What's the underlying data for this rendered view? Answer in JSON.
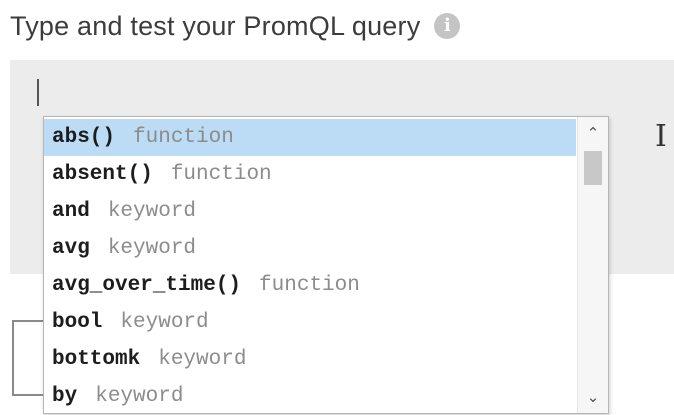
{
  "header": {
    "title": "Type and test your PromQL query",
    "info_icon": "info-icon",
    "info_glyph": "i"
  },
  "editor": {
    "value": "",
    "mouse_cursor": "text-cursor-icon",
    "mouse_glyph": "I"
  },
  "autocomplete": {
    "selected_index": 0,
    "items": [
      {
        "name": "abs()",
        "type": "function"
      },
      {
        "name": "absent()",
        "type": "function"
      },
      {
        "name": "and",
        "type": "keyword"
      },
      {
        "name": "avg",
        "type": "keyword"
      },
      {
        "name": "avg_over_time()",
        "type": "function"
      },
      {
        "name": "bool",
        "type": "keyword"
      },
      {
        "name": "bottomk",
        "type": "keyword"
      },
      {
        "name": "by",
        "type": "keyword"
      }
    ],
    "scroll_up_glyph": "⌃",
    "scroll_down_glyph": "⌄"
  },
  "colors": {
    "selected_row": "#bcdcf6",
    "editor_background": "#ececec",
    "type_text": "#8c8c8c"
  }
}
